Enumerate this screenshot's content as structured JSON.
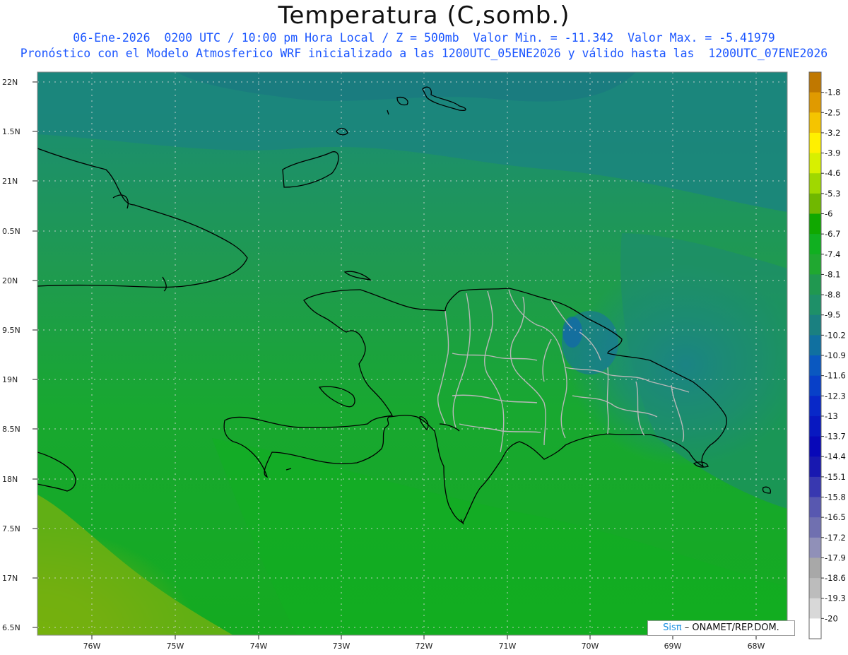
{
  "header": {
    "title": "Temperatura (C,somb.)",
    "line1": "06-Ene-2026  0200 UTC / 10:00 pm Hora Local / Z = 500mb  Valor Min. = -11.342  Valor Max. = -5.41979",
    "line2": "Pronóstico con el Modelo Atmosferico WRF inicializado a las 1200UTC_05ENE2026 y válido hasta las  1200UTC_07ENE2026"
  },
  "axes": {
    "lat_labels": [
      "22N",
      "1.5N",
      "21N",
      "0.5N",
      "20N",
      "9.5N",
      "19N",
      "8.5N",
      "18N",
      "7.5N",
      "17N",
      "6.5N"
    ],
    "lon_labels": [
      "76W",
      "75W",
      "74W",
      "73W",
      "72W",
      "71W",
      "70W",
      "69W",
      "68W"
    ]
  },
  "colorbar": {
    "labels": [
      "-1.8",
      "-2.5",
      "-3.2",
      "-3.9",
      "-4.6",
      "-5.3",
      "-6",
      "-6.7",
      "-7.4",
      "-8.1",
      "-8.8",
      "-9.5",
      "-10.2",
      "-10.9",
      "-11.6",
      "-12.3",
      "-13",
      "-13.7",
      "-14.4",
      "-15.1",
      "-15.8",
      "-16.5",
      "-17.2",
      "-17.9",
      "-18.6",
      "-19.3",
      "-20"
    ],
    "colors": [
      "#c07800",
      "#e09a00",
      "#f5c400",
      "#fff000",
      "#d8f000",
      "#a0d800",
      "#70b800",
      "#10a800",
      "#10b020",
      "#20a830",
      "#209850",
      "#1e9068",
      "#1a8080",
      "#1070a0",
      "#0a58c0",
      "#0840c8",
      "#0828c8",
      "#0818c0",
      "#0808b8",
      "#1818b0",
      "#3838b0",
      "#5858b0",
      "#7070b0",
      "#9090b8",
      "#a8a8a8",
      "#bcbcbc",
      "#d8d8d8",
      "#ffffff"
    ]
  },
  "credit": {
    "brand": "Sisπ",
    "org": "– ONAMET/REP.DOM."
  }
}
